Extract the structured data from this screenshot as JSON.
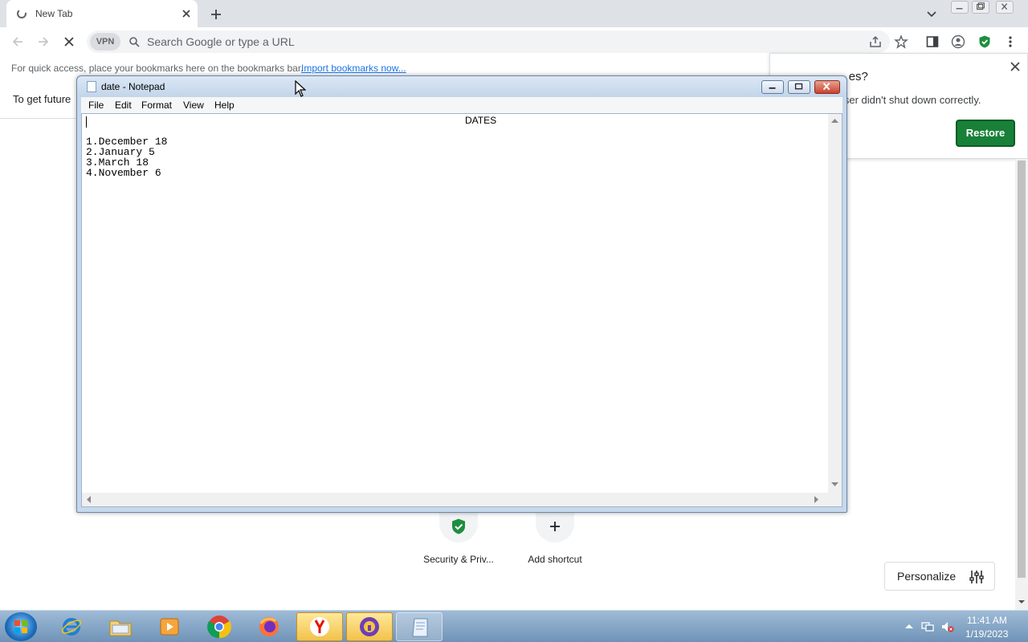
{
  "browser": {
    "tab_title": "New Tab",
    "omnibox_placeholder": "Search Google or type a URL",
    "vpn_label": "VPN",
    "bookmarks_hint": "For quick access, place your bookmarks here on the bookmarks bar.",
    "import_link": "Import bookmarks now...",
    "infobar_text": "To get future",
    "restore_popup": {
      "title_fragment": "es?",
      "message": "Browser didn't shut down correctly.",
      "restore_label": "Restore"
    },
    "shortcuts": [
      {
        "label": "Security & Priv...",
        "icon": "shield-check-icon"
      },
      {
        "label": "Add shortcut",
        "icon": "plus-icon"
      }
    ],
    "personalize_label": "Personalize"
  },
  "notepad": {
    "title": "date - Notepad",
    "menu": [
      "File",
      "Edit",
      "Format",
      "View",
      "Help"
    ],
    "heading": "DATES",
    "lines": [
      "1.December 18",
      "2.January 5",
      "3.March 18",
      "4.November 6"
    ]
  },
  "taskbar": {
    "time": "11:41 AM",
    "date": "1/19/2023",
    "apps": [
      "internet-explorer",
      "file-explorer",
      "media-player",
      "chrome",
      "firefox",
      "yandex",
      "vpn-app",
      "notepad"
    ]
  },
  "colors": {
    "accent_green": "#188038",
    "link_blue": "#1a73e8"
  }
}
